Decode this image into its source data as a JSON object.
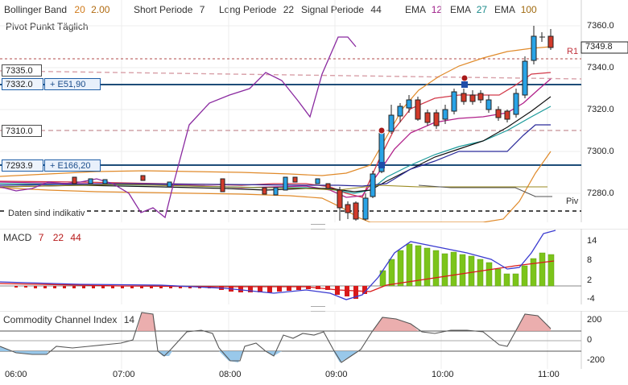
{
  "header": {
    "bollinger": {
      "name": "Bollinger Band",
      "p1": "20",
      "p2": "2.00",
      "p1_color": "#d07a1a",
      "p2_color": "#b06a10"
    },
    "short": {
      "name": "Short Periode",
      "value": "7"
    },
    "long": {
      "name": "Long Periode",
      "value": "22"
    },
    "signal": {
      "name": "Signal Periode",
      "value": "44"
    },
    "ema": [
      {
        "name": "EMA",
        "value": "12",
        "color": "#a0208a"
      },
      {
        "name": "EMA",
        "value": "27",
        "color": "#1a8a8a"
      },
      {
        "name": "EMA",
        "value": "100",
        "color": "#a06a10"
      }
    ],
    "pivot": "Pivot Punkt  Täglich"
  },
  "price_axis": [
    "7360.0",
    "7340.0",
    "7320.0",
    "7300.0",
    "7280.0"
  ],
  "current_price": "7349.8",
  "r1_label": "R1",
  "piv_label": "Piv",
  "indicative": "Daten sind indikativ",
  "tags": {
    "t1": "7335.0",
    "t2_price": "7332.0",
    "t2_pl": "+ E51,90",
    "t3": "7310.0",
    "t4_price": "7293.9",
    "t4_pl": "+ E166,20"
  },
  "macd": {
    "name": "MACD",
    "p1": "7",
    "p2": "22",
    "p3": "44",
    "axis": [
      "14",
      "8",
      "2",
      "-4"
    ]
  },
  "cci": {
    "name": "Commodity Channel Index",
    "period": "14",
    "axis": [
      "200",
      "0",
      "-200"
    ]
  },
  "time_axis": [
    "06:00",
    "07:00",
    "08:00",
    "09:00",
    "10:00",
    "11:00"
  ],
  "colors": {
    "bull": "#29a3e6",
    "bear": "#d23a2a",
    "macd_pos": "#7cc41a",
    "macd_neg": "#d81a1a",
    "accent_line": "#1e4d78"
  }
}
